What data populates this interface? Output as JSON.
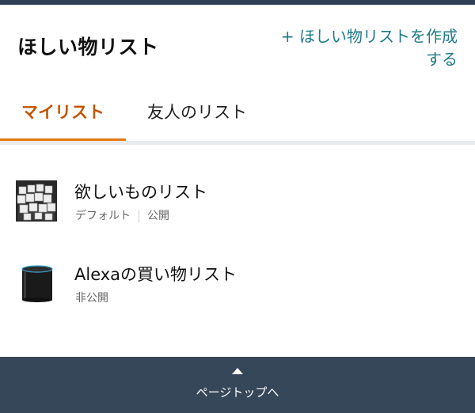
{
  "header": {
    "title": "ほしい物リスト",
    "create_link_line1": "+ ほしい物リストを作成",
    "create_link_line2": "する"
  },
  "tabs": [
    {
      "label": "マイリスト",
      "active": true
    },
    {
      "label": "友人のリスト",
      "active": false
    }
  ],
  "lists": [
    {
      "title": "欲しいものリスト",
      "default_label": "デフォルト",
      "visibility": "公開",
      "thumbnail_icon": "white-cubes-thumbnail"
    },
    {
      "title": "Alexaの買い物リスト",
      "visibility": "非公開",
      "thumbnail_icon": "echo-speaker-thumbnail"
    }
  ],
  "footer": {
    "label": "ページトップへ",
    "icon": "triangle-up-icon"
  },
  "colors": {
    "accent": "#c45500",
    "tab_indicator": "#e47911",
    "link": "#1f7a8a",
    "footer_bg": "#37475a",
    "top_strip": "#2f3d52"
  }
}
